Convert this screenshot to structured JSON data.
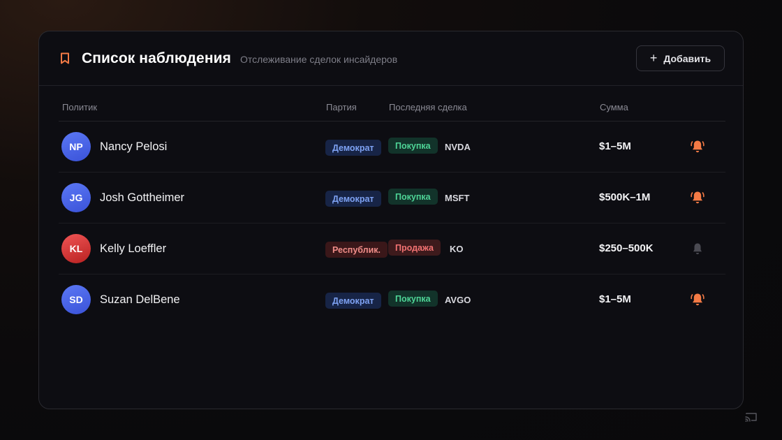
{
  "header": {
    "icon": "bookmark-icon",
    "title": "Список наблюдения",
    "subtitle": "Отслеживание сделок инсайдеров",
    "add_label": "Добавить",
    "accent_color": "#f47a45"
  },
  "table": {
    "columns": {
      "politician": "Политик",
      "party": "Партия",
      "last_trade": "Последняя сделка",
      "amount": "Сумма"
    },
    "rows": [
      {
        "initials": "NP",
        "name": "Nancy Pelosi",
        "party": "Демократ",
        "trade": "Покупка",
        "ticker": "NVDA",
        "amount": "$1–5M",
        "alert_active": true
      },
      {
        "initials": "JG",
        "name": "Josh Gottheimer",
        "party": "Демократ",
        "trade": "Покупка",
        "ticker": "MSFT",
        "amount": "$500K–1M",
        "alert_active": true
      },
      {
        "initials": "KL",
        "name": "Kelly Loeffler",
        "party": "Республик.",
        "trade": "Продажа",
        "ticker": "KO",
        "amount": "$250–500K",
        "alert_active": false
      },
      {
        "initials": "SD",
        "name": "Suzan DelBene",
        "party": "Демократ",
        "trade": "Покупка",
        "ticker": "AVGO",
        "amount": "$1–5M",
        "alert_active": true
      }
    ]
  },
  "colors": {
    "democrat": "#7ea2f3",
    "republican": "#f08d89",
    "buy": "#4ed496",
    "sell": "#f27272",
    "alert_on": "#f47a45",
    "alert_off": "#4a4a52"
  }
}
